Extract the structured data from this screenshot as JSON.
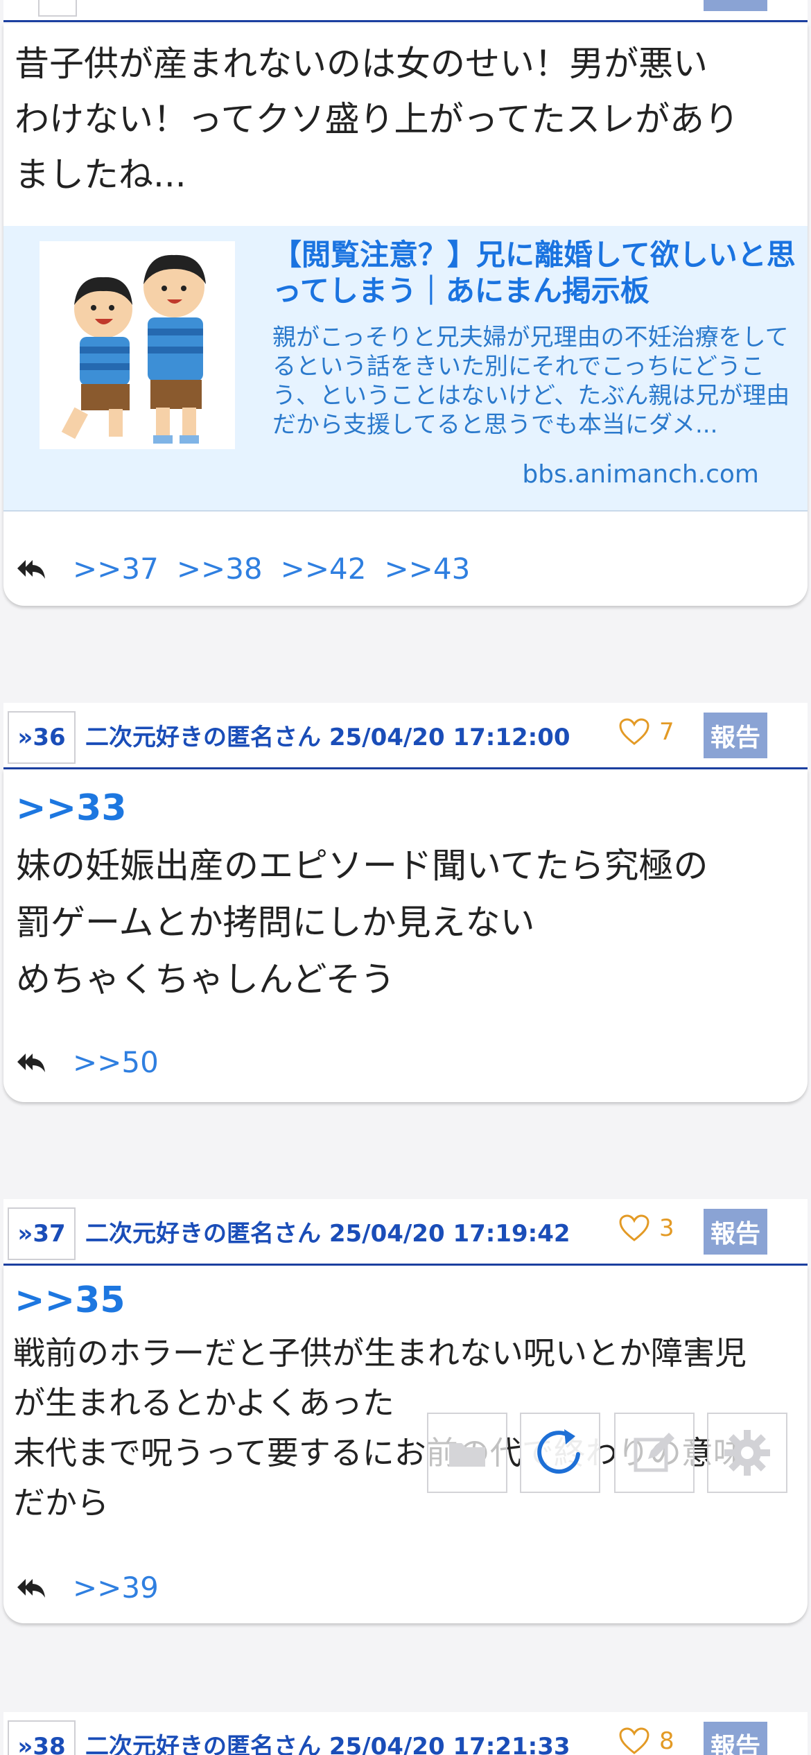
{
  "post35": {
    "header_num": "",
    "body_lines": [
      "昔子供が産まれないのは女のせい！男が悪い",
      "わけない！ってクソ盛り上がってたスレがあり",
      "ましたね..."
    ],
    "link": {
      "title": "【閲覧注意？】兄に離婚して欲しいと思ってしまう｜あにまん掲示板",
      "description": "親がこっそりと兄夫婦が兄理由の不妊治療をしてるという話をきいた別にそれでこっちにどうこう、ということはないけど、たぶん親は兄が理由だから支援してると思うでも本当にダメ...",
      "domain": "bbs.animanch.com"
    },
    "replies": [
      ">>37",
      ">>38",
      ">>42",
      ">>43"
    ]
  },
  "post36": {
    "num": "»36",
    "poster": "二次元好きの匿名さん 25/04/20 17:12:00",
    "likes": "7",
    "report": "報告",
    "anchor": ">>33",
    "body_lines": [
      "妹の妊娠出産のエピソード聞いてたら究極の",
      "罰ゲームとか拷問にしか見えない",
      "めちゃくちゃしんどそう"
    ],
    "replies": [
      ">>50"
    ]
  },
  "post37": {
    "num": "»37",
    "poster": "二次元好きの匿名さん 25/04/20 17:19:42",
    "likes": "3",
    "report": "報告",
    "anchor": ">>35",
    "body_lines": [
      "戦前のホラーだと子供が生まれない呪いとか障害児",
      "が生まれるとかよくあった",
      "末代まで呪うって要するにお前の代で終わりの意味",
      "だから"
    ],
    "replies": [
      ">>39"
    ]
  },
  "post38": {
    "num": "»38",
    "poster": "二次元好きの匿名さん 25/04/20 17:21:33",
    "likes": "8",
    "report": "報告"
  },
  "toolbar": {
    "icons": [
      "folder-icon",
      "refresh-icon",
      "edit-icon",
      "gear-icon"
    ]
  },
  "colors": {
    "accent_blue": "#1a4db8",
    "link_blue": "#1d77e0",
    "like_orange": "#e39a25",
    "report_bg": "#8aa3d4",
    "link_card_bg": "#e6f3ff"
  }
}
